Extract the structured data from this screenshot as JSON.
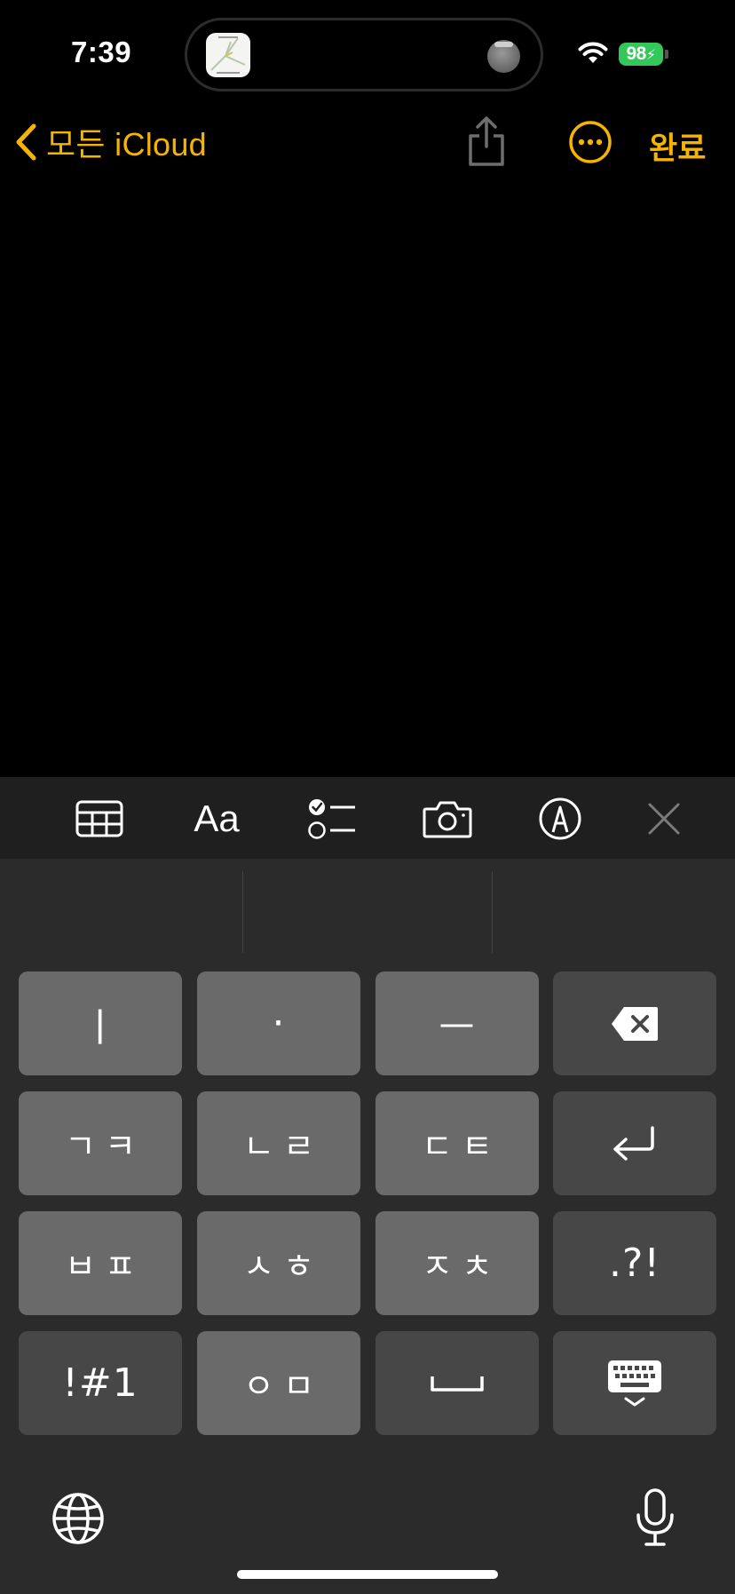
{
  "status_bar": {
    "time": "7:39",
    "battery": "98"
  },
  "nav": {
    "back_label": "모든 iCloud",
    "done_label": "완료"
  },
  "format_bar": {
    "text_style_label": "Aa"
  },
  "suggestions": [
    "",
    "",
    ""
  ],
  "keyboard": {
    "rows": [
      [
        "ㅣ",
        "·",
        "ㅡ",
        ""
      ],
      [
        "ㄱㅋ",
        "ㄴㄹ",
        "ㄷㅌ",
        ""
      ],
      [
        "ㅂㅍ",
        "ㅅㅎ",
        "ㅈㅊ",
        ".?!"
      ],
      [
        "!#1",
        "ㅇㅁ",
        "",
        ""
      ]
    ]
  },
  "colors": {
    "accent": "#f5b400",
    "key_light": "#6a6a6a",
    "key_dark": "#474747",
    "keyboard_bg": "#2b2b2b"
  }
}
